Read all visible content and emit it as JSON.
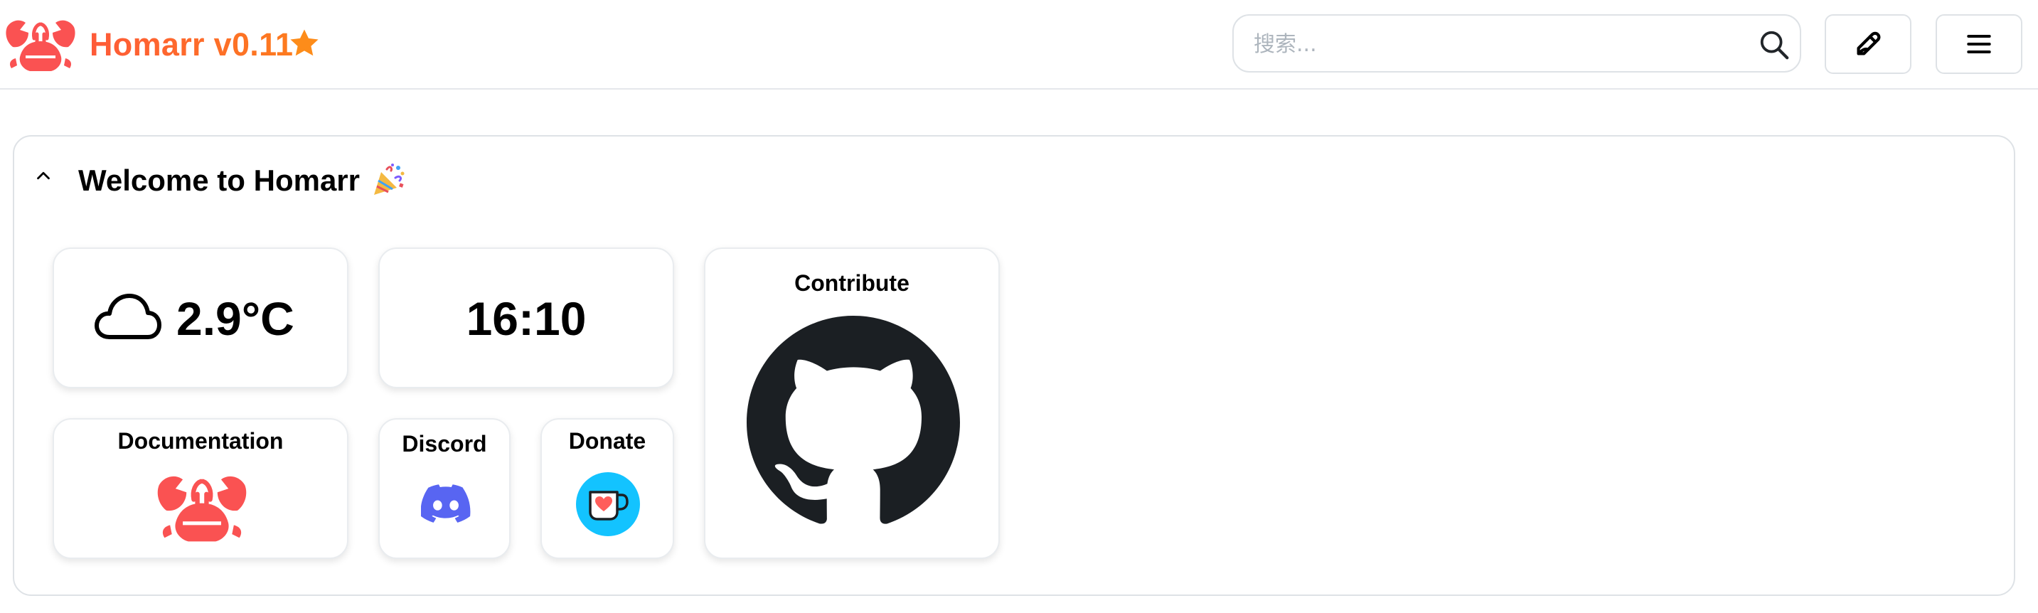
{
  "header": {
    "app_title": "Homarr v0.11",
    "logo_icon": "homarr-crab-logo",
    "star_icon": "star-icon",
    "search": {
      "placeholder": "搜索...",
      "value": ""
    },
    "edit_button_icon": "pencil-edit-icon",
    "menu_button_icon": "hamburger-menu-icon"
  },
  "category": {
    "title": "Welcome to Homarr",
    "title_emoji": "party-popper-icon",
    "collapse_icon": "chevron-up-icon"
  },
  "tiles": {
    "weather": {
      "icon": "cloud-icon",
      "temperature": "2.9°C"
    },
    "clock": {
      "time": "16:10"
    },
    "contribute": {
      "title": "Contribute",
      "icon": "github-icon"
    },
    "documentation": {
      "title": "Documentation",
      "icon": "homarr-crab-logo"
    },
    "discord": {
      "title": "Discord",
      "icon": "discord-icon"
    },
    "donate": {
      "title": "Donate",
      "icon": "ko-fi-cup-icon"
    }
  },
  "colors": {
    "brand_gradient_start": "#fe5a38",
    "brand_gradient_end": "#fd7b1e",
    "crab_red": "#fa5252",
    "star": "#fd8c1a",
    "discord": "#5865f2",
    "kofi_bg": "#13c3ff",
    "github": "#1b1f23"
  }
}
